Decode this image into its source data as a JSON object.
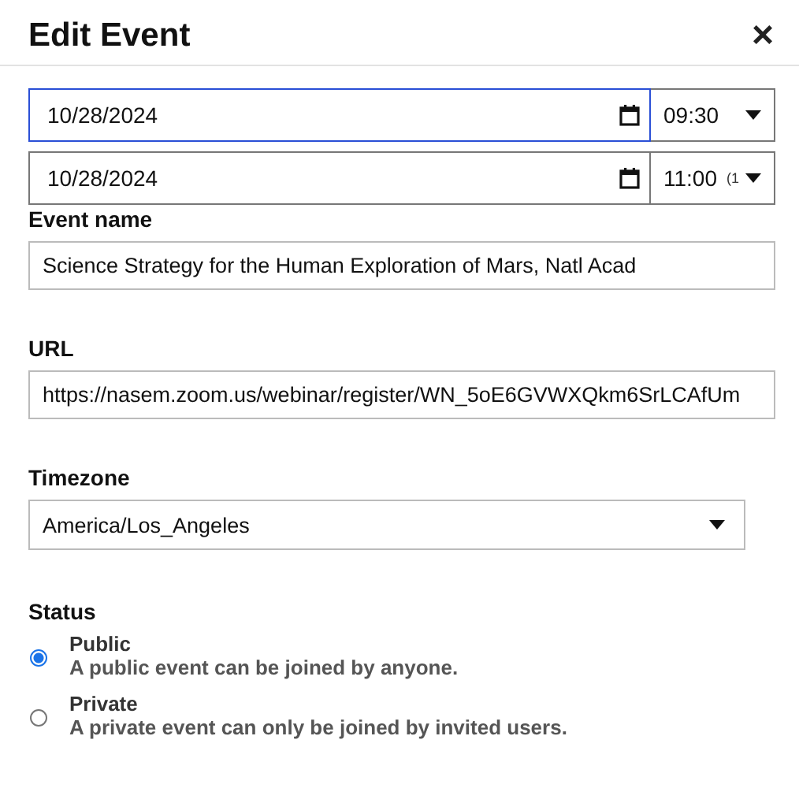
{
  "dialog": {
    "title": "Edit Event",
    "close": "×"
  },
  "schedule": [
    {
      "date": "10/28/2024",
      "time": "09:30",
      "focused": true
    },
    {
      "date": "10/28/2024",
      "time": "11:00",
      "duration": "(1",
      "focused": false
    }
  ],
  "fields": [
    {
      "label": "Event name",
      "value": "Science Strategy for the Human Exploration of Mars, Natl Acad"
    },
    {
      "label": "URL",
      "value": "https://nasem.zoom.us/webinar/register/WN_5oE6GVWXQkm6SrLCAfUm"
    }
  ],
  "timezone": {
    "label": "Timezone",
    "value": "America/Los_Angeles"
  },
  "status": {
    "label": "Status",
    "options": [
      {
        "title": "Public",
        "description": "A public event can be joined by anyone.",
        "selected": true
      },
      {
        "title": "Private",
        "description": "A private event can only be joined by invited users.",
        "selected": false
      }
    ]
  }
}
